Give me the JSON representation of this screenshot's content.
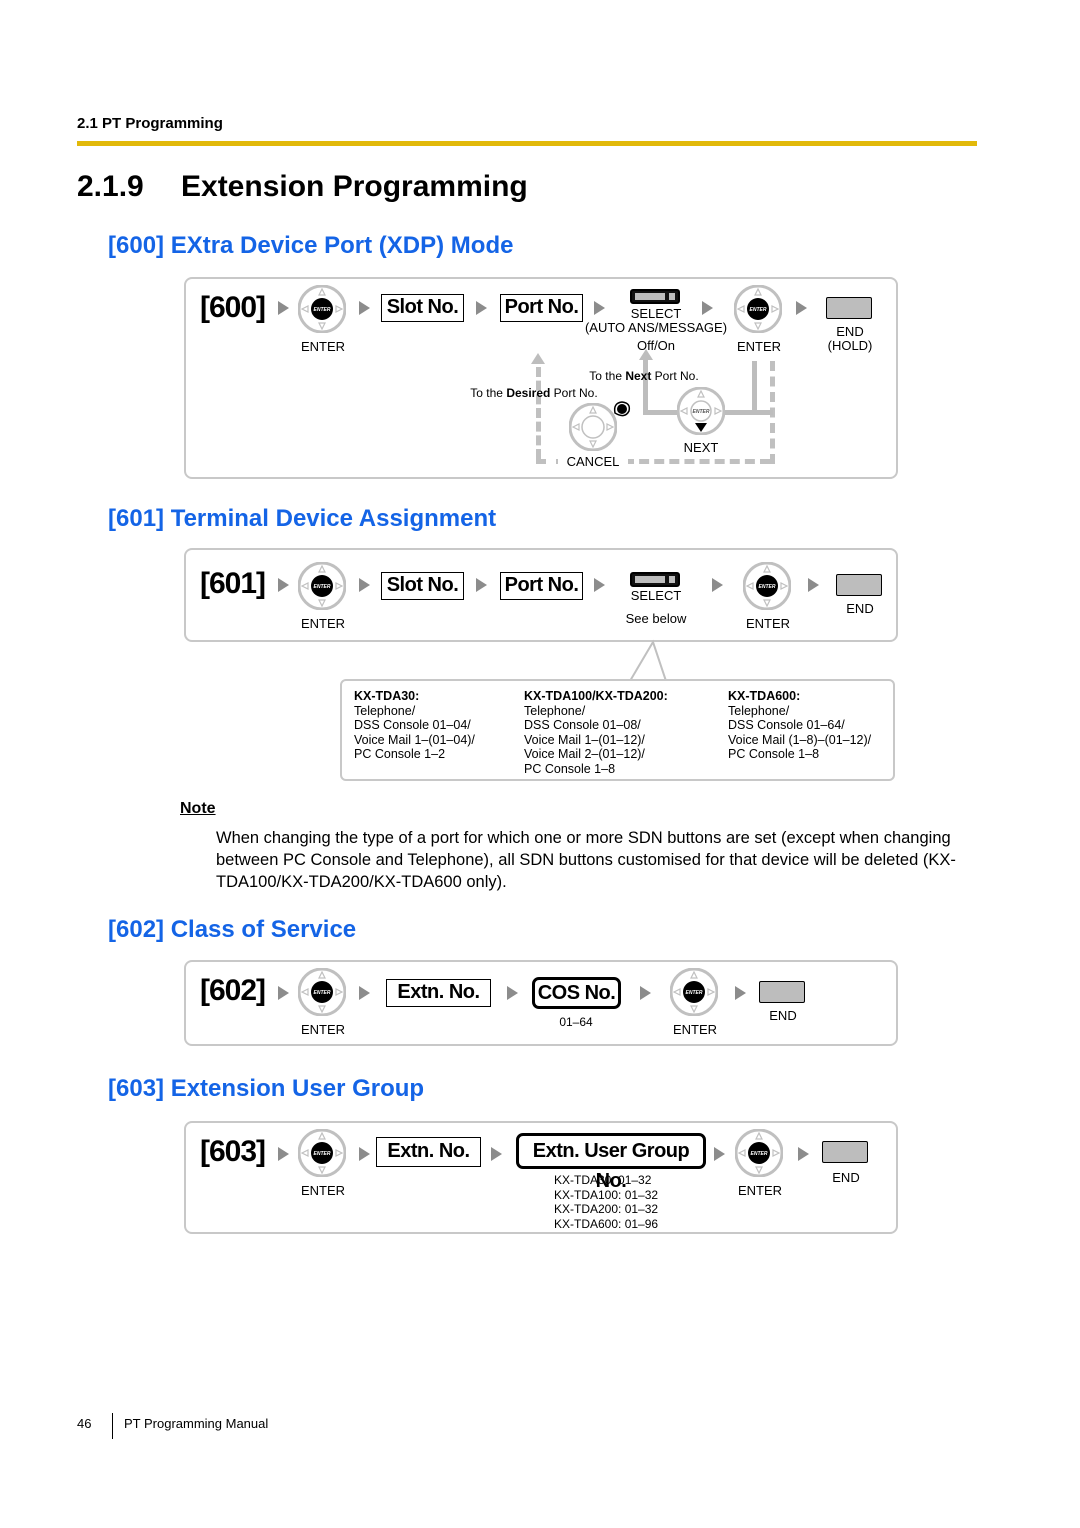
{
  "header": {
    "section_label": "2.1 PT Programming",
    "rule_color": "#e2b90a"
  },
  "title": {
    "number": "2.1.9",
    "text": "Extension Programming"
  },
  "heading_color": "#1464e6",
  "sections": [
    {
      "heading": "[600] EXtra Device Port (XDP) Mode",
      "code": "[600]",
      "enter_label": "ENTER",
      "slot_label": "Slot No.",
      "port_label": "Port No.",
      "select_label": "SELECT",
      "select_sub": "(AUTO ANS/MESSAGE)",
      "select_value": "Off/On",
      "enter2_label": "ENTER",
      "end_label": "END",
      "end_sub": "(HOLD)",
      "next_port_prefix": "To the ",
      "next_port_bold": "Next",
      "next_port_suffix": " Port No.",
      "desired_port_prefix": "To the ",
      "desired_port_bold": "Desired",
      "desired_port_suffix": " Port No.",
      "next_label": "NEXT",
      "cancel_label": "CANCEL"
    },
    {
      "heading": "[601] Terminal Device Assignment",
      "code": "[601]",
      "enter_label": "ENTER",
      "slot_label": "Slot No.",
      "port_label": "Port No.",
      "select_label": "SELECT",
      "select_value": "See below",
      "enter2_label": "ENTER",
      "end_label": "END",
      "models": [
        {
          "name": "KX-TDA30:",
          "lines": [
            "Telephone/",
            "DSS Console 01–04/",
            "Voice Mail 1–(01–04)/",
            "PC Console 1–2"
          ]
        },
        {
          "name": "KX-TDA100/KX-TDA200:",
          "lines": [
            "Telephone/",
            "DSS Console 01–08/",
            "Voice Mail 1–(01–12)/",
            "Voice Mail 2–(01–12)/",
            "PC Console 1–8"
          ]
        },
        {
          "name": "KX-TDA600:",
          "lines": [
            "Telephone/",
            "DSS Console 01–64/",
            "Voice Mail (1–8)–(01–12)/",
            "PC Console 1–8"
          ]
        }
      ]
    },
    {
      "heading": "[602] Class of Service",
      "code": "[602]",
      "enter_label": "ENTER",
      "extn_label": "Extn. No.",
      "cos_label": "COS No.",
      "cos_range": "01–64",
      "enter2_label": "ENTER",
      "end_label": "END"
    },
    {
      "heading": "[603] Extension User Group",
      "code": "[603]",
      "enter_label": "ENTER",
      "extn_label": "Extn. No.",
      "group_label": "Extn. User Group No.",
      "ranges": [
        "KX-TDA30: 01–32",
        "KX-TDA100: 01–32",
        "KX-TDA200: 01–32",
        "KX-TDA600: 01–96"
      ],
      "enter2_label": "ENTER",
      "end_label": "END"
    }
  ],
  "note": {
    "title": "Note",
    "body": "When changing the type of a port for which one or more SDN buttons are set (except when changing between PC Console and Telephone), all SDN buttons customised for that device will be deleted (KX-TDA100/KX-TDA200/KX-TDA600 only)."
  },
  "footer": {
    "page_number": "46",
    "manual_title": "PT Programming Manual"
  }
}
